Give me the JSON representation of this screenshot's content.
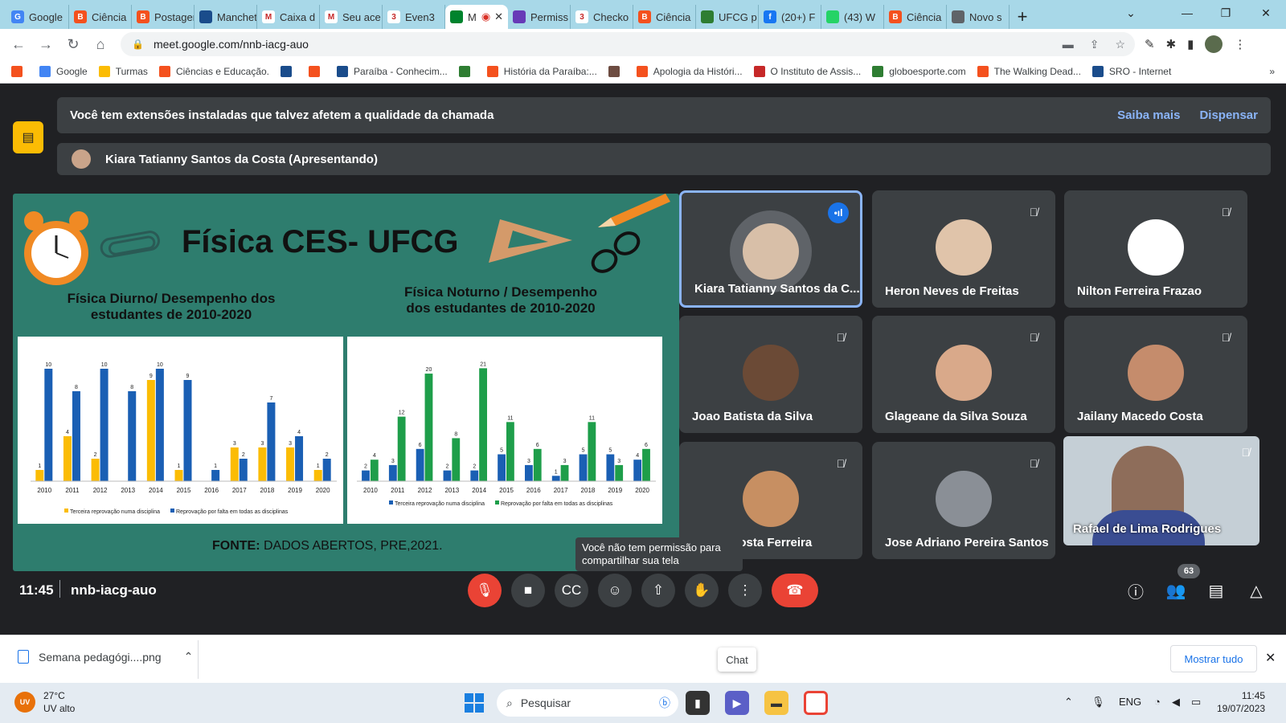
{
  "browser": {
    "tabs": [
      {
        "label": "Google",
        "color": "#4285f4",
        "glyph": "G"
      },
      {
        "label": "Ciência",
        "color": "#f4511e",
        "glyph": "B"
      },
      {
        "label": "Postagem",
        "color": "#f4511e",
        "glyph": "B"
      },
      {
        "label": "Manchete",
        "color": "#1a4c8b",
        "glyph": ""
      },
      {
        "label": "Caixa d",
        "color": "#ffffff",
        "glyph": "M"
      },
      {
        "label": "Seu ace",
        "color": "#ffffff",
        "glyph": "M"
      },
      {
        "label": "Even3",
        "color": "#ffffff",
        "glyph": "3"
      },
      {
        "label": "M",
        "color": "#00832d",
        "glyph": ""
      },
      {
        "label": "Permiss",
        "color": "#673ab7",
        "glyph": ""
      },
      {
        "label": "Checko",
        "color": "#ffffff",
        "glyph": "3"
      },
      {
        "label": "Ciência",
        "color": "#f4511e",
        "glyph": "B"
      },
      {
        "label": "UFCG p",
        "color": "#2e7d32",
        "glyph": ""
      },
      {
        "label": "(20+) F",
        "color": "#1877f2",
        "glyph": "f"
      },
      {
        "label": "(43) W",
        "color": "#25d366",
        "glyph": ""
      },
      {
        "label": "Ciência",
        "color": "#f4511e",
        "glyph": "B"
      },
      {
        "label": "Novo s",
        "color": "#5f6368",
        "glyph": ""
      }
    ],
    "url": "meet.google.com/nnb-iacg-auo",
    "bookmarks": [
      {
        "label": "",
        "color": "#f4511e"
      },
      {
        "label": "Google",
        "color": "#4285f4"
      },
      {
        "label": "Turmas",
        "color": "#fbbc04"
      },
      {
        "label": "Ciências e Educação.",
        "color": "#f4511e"
      },
      {
        "label": "",
        "color": "#1a4c8b"
      },
      {
        "label": "",
        "color": "#f4511e"
      },
      {
        "label": "Paraíba - Conhecim...",
        "color": "#1a4c8b"
      },
      {
        "label": "",
        "color": "#2e7d32"
      },
      {
        "label": "História da Paraíba:...",
        "color": "#f4511e"
      },
      {
        "label": "",
        "color": "#6d4c41"
      },
      {
        "label": "Apologia da Históri...",
        "color": "#f4511e"
      },
      {
        "label": "O Instituto de Assis...",
        "color": "#c62828"
      },
      {
        "label": "globoesporte.com",
        "color": "#2e7d32"
      },
      {
        "label": "The Walking Dead...",
        "color": "#f4511e"
      },
      {
        "label": "SRO - Internet",
        "color": "#1a4c8b"
      }
    ],
    "bookmarks_more": "»"
  },
  "meet": {
    "notice": "Você tem extensões instaladas que talvez afetem a qualidade da chamada",
    "notice_learn": "Saiba mais",
    "notice_dismiss": "Dispensar",
    "presenter": "Kiara Tatianny Santos da Costa (Apresentando)",
    "participants": [
      {
        "name": "Kiara Tatianny Santos da C...",
        "speaking": true
      },
      {
        "name": "Heron Neves de Freitas",
        "speaking": false
      },
      {
        "name": "Nilton Ferreira Frazao",
        "speaking": false
      },
      {
        "name": "Joao Batista da Silva",
        "speaking": false
      },
      {
        "name": "Glageane da Silva Souza",
        "speaking": false
      },
      {
        "name": "Jailany Macedo Costa",
        "speaking": false
      },
      {
        "name": "T      e da Costa Ferreira",
        "speaking": false
      },
      {
        "name": "Jose Adriano Pereira Santos",
        "speaking": false
      }
    ],
    "self_name": "Rafael de Lima Rodrigues",
    "tooltip": "Você não tem permissão para compartilhar sua tela",
    "time": "11:45",
    "meeting_code": "nnb-iacg-auo",
    "participant_count": "63"
  },
  "slide": {
    "title": "Física CES- UFCG",
    "left_subtitle": "Física Diurno/ Desempenho dos estudantes de 2010-2020",
    "right_subtitle": "Física Noturno / Desempenho dos estudantes de 2010-2020",
    "source_bold": "FONTE:",
    "source_text": " DADOS ABERTOS, PRE,2021."
  },
  "chart_data": [
    {
      "type": "bar",
      "title": "Física Diurno/ Desempenho dos estudantes de 2010-2020",
      "categories": [
        "2010",
        "2011",
        "2012",
        "2013",
        "2014",
        "2015",
        "2016",
        "2017",
        "2018",
        "2019",
        "2020"
      ],
      "series": [
        {
          "name": "Terceira reprovação numa disciplina",
          "color": "#fbbc04",
          "values": [
            1,
            4,
            2,
            0,
            9,
            1,
            0,
            3,
            3,
            3,
            1
          ]
        },
        {
          "name": "Reprovação por falta em todas as disciplinas",
          "color": "#1a5fb4",
          "values": [
            10,
            8,
            10,
            8,
            10,
            9,
            1,
            2,
            7,
            4,
            2
          ]
        }
      ],
      "ylim": [
        0,
        11
      ]
    },
    {
      "type": "bar",
      "title": "Física Noturno / Desempenho dos estudantes de 2010-2020",
      "categories": [
        "2010",
        "2011",
        "2012",
        "2013",
        "2014",
        "2015",
        "2016",
        "2017",
        "2018",
        "2019",
        "2020"
      ],
      "series": [
        {
          "name": "Terceira reprovação numa disciplina",
          "color": "#1a5fb4",
          "values": [
            2,
            3,
            6,
            2,
            2,
            5,
            3,
            1,
            5,
            5,
            4
          ]
        },
        {
          "name": "Reprovação por falta em todas as disciplinas",
          "color": "#1e9e4a",
          "values": [
            4,
            12,
            20,
            8,
            21,
            11,
            6,
            3,
            11,
            3,
            6
          ]
        }
      ],
      "ylim": [
        0,
        23
      ]
    }
  ],
  "download": {
    "file": "Semana pedagógi....png",
    "chat_tip": "Chat",
    "show_all": "Mostrar tudo"
  },
  "taskbar": {
    "temp": "27°C",
    "weather": "UV alto",
    "uv_badge": "UV",
    "search": "Pesquisar",
    "lang": "ENG",
    "time": "11:45",
    "date": "19/07/2023"
  }
}
